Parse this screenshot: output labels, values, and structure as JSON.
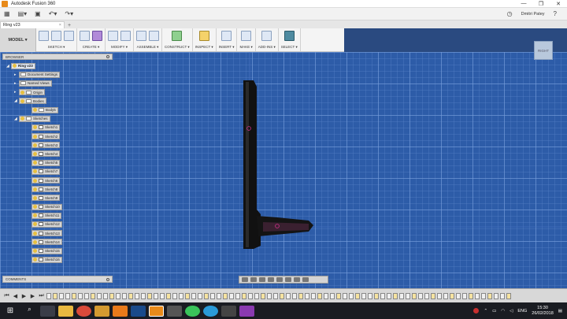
{
  "window": {
    "title": "Autodesk Fusion 360",
    "minimize": "—",
    "maximize": "❐",
    "close": "✕"
  },
  "qat": {
    "user": "Dmitri Patey",
    "help": "?"
  },
  "doc_tab": {
    "name": "Ring v23",
    "close": "×",
    "plus": "+"
  },
  "ribbon": {
    "workspace": "MODEL ▾",
    "groups": [
      {
        "label": "SKETCH ▾"
      },
      {
        "label": "CREATE ▾"
      },
      {
        "label": "MODIFY ▾"
      },
      {
        "label": "ASSEMBLE ▾"
      },
      {
        "label": "CONSTRUCT ▾"
      },
      {
        "label": "INSPECT ▾"
      },
      {
        "label": "INSERT ▾"
      },
      {
        "label": "MAKE ▾"
      },
      {
        "label": "ADD-INS ▾"
      },
      {
        "label": "SELECT ▾"
      }
    ]
  },
  "viewcube": {
    "face": "RIGHT"
  },
  "browser": {
    "title": "BROWSER",
    "items": [
      {
        "label": "Ring v23"
      },
      {
        "label": "Document Settings"
      },
      {
        "label": "Named Views"
      },
      {
        "label": "Origin"
      },
      {
        "label": "Bodies"
      },
      {
        "label": "Body5"
      },
      {
        "label": "Sketches"
      },
      {
        "label": "Sketch1"
      },
      {
        "label": "Sketch2"
      },
      {
        "label": "Sketch3"
      },
      {
        "label": "Sketch4"
      },
      {
        "label": "Sketch5"
      },
      {
        "label": "Sketch7"
      },
      {
        "label": "Sketch6"
      },
      {
        "label": "Sketch8"
      },
      {
        "label": "Sketch9"
      },
      {
        "label": "Sketch10"
      },
      {
        "label": "Sketch11"
      },
      {
        "label": "Sketch12"
      },
      {
        "label": "Sketch13"
      },
      {
        "label": "Sketch14"
      },
      {
        "label": "Sketch15"
      },
      {
        "label": "Sketch16"
      }
    ]
  },
  "comments": {
    "title": "COMMENTS"
  },
  "timeline": {
    "first": "⏮",
    "prev": "◀",
    "play": "▶",
    "next": "▶",
    "last": "⏭"
  },
  "taskbar": {
    "start": "⊞",
    "lang": "ENG",
    "time": "15:30",
    "date": "26/02/2018"
  },
  "colors": {
    "canvas": "#2d5ca8",
    "model": "#111111",
    "accent": "#e88a1a"
  }
}
